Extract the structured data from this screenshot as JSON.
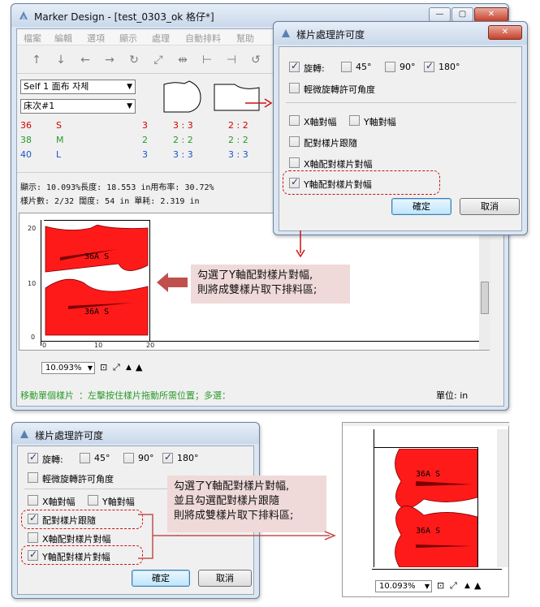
{
  "main_window": {
    "title": "Marker Design - [test_0303_ok 格仔*]",
    "controls": [
      "—",
      "▢",
      "✕"
    ],
    "menu": [
      "檔案",
      "編輯",
      "選項",
      "顯示",
      "處理",
      "自動排料",
      "幫助"
    ],
    "fabric_combo": "Self 1 面布 자체",
    "bed_combo": "床次#1",
    "sizes": [
      {
        "num": "36",
        "size": "S",
        "qty": "3",
        "a": "3 : 3",
        "b": "2 : 2"
      },
      {
        "num": "38",
        "size": "M",
        "qty": "2",
        "a": "2 : 2",
        "b": "2 : 2"
      },
      {
        "num": "40",
        "size": "L",
        "qty": "3",
        "a": "3 : 3",
        "b": "3 : 3"
      }
    ],
    "stats_line1": "顯示:  10.093%長度:  18.553 in用布率: 30.72%",
    "stats_line2": "樣片數: 2/32   闊度:  54 in        單耗:  2.319 in",
    "piece_label": "36A  S",
    "zoom": "10.093%",
    "status_hint": "移動單個樣片",
    "status_text": "：左擊按住樣片拖動所需位置；多選：",
    "status_unit": "單位: in",
    "v_ticks": [
      "20",
      "10",
      "0"
    ],
    "h_ticks": [
      "0",
      "10",
      "20"
    ]
  },
  "dialog_top": {
    "title": "樣片處理許可度",
    "close": "✕",
    "opt_rotate": "旋轉:",
    "deg45": "45°",
    "deg90": "90°",
    "deg180": "180°",
    "opt_slight": "輕微旋轉許可角度",
    "opt_x_align": "X軸對幅",
    "opt_y_align": "Y軸對幅",
    "opt_pair_follow": "配對樣片跟隨",
    "opt_x_pair": "X軸配對樣片對幅",
    "opt_y_pair": "Y軸配對樣片對幅",
    "ok": "確定",
    "cancel": "取消",
    "checked": {
      "rotate": true,
      "d45": false,
      "d90": false,
      "d180": true,
      "slight": false,
      "x_align": false,
      "y_align": false,
      "pair_follow": false,
      "x_pair": false,
      "y_pair": true
    }
  },
  "callout_top": {
    "line1": "勾選了Y軸配對樣片對幅,",
    "line2": "則將成雙樣片取下排料區;"
  },
  "dialog_bottom": {
    "title": "樣片處理許可度",
    "checked": {
      "rotate": true,
      "d45": false,
      "d90": false,
      "d180": true,
      "slight": false,
      "x_align": false,
      "y_align": false,
      "pair_follow": true,
      "x_pair": false,
      "y_pair": true
    }
  },
  "callout_bottom": {
    "line1": "勾選了Y軸配對樣片對幅,",
    "line2": "並且勾選配對樣片跟隨",
    "line3": "則將成雙樣片取下排料區;"
  },
  "bottom_right": {
    "zoom": "10.093%",
    "piece_label": "36A  S"
  },
  "colors": {
    "piece_red": "#ff1a1a",
    "callout_bg": "#efd9d9",
    "arrow_red": "#c0504d"
  }
}
